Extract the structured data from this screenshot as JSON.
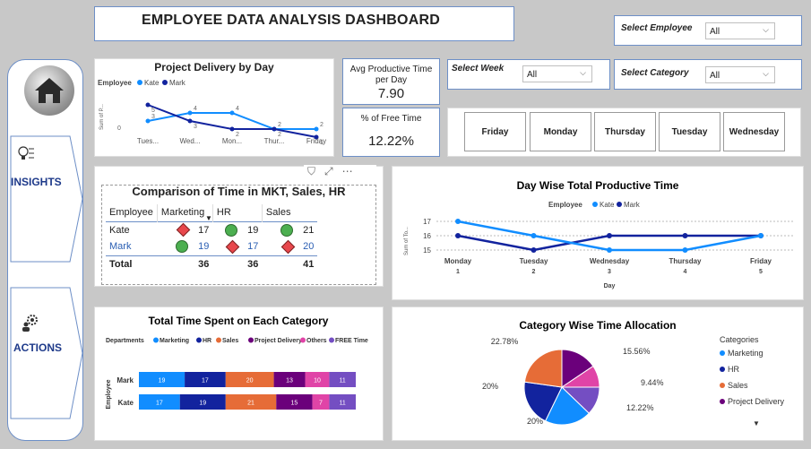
{
  "page_title": "EMPLOYEE DATA ANALYSIS DASHBOARD",
  "slicers": {
    "employee": {
      "label": "Select Employee",
      "value": "All"
    },
    "week": {
      "label": "Select Week",
      "value": "All"
    },
    "category": {
      "label": "Select Category",
      "value": "All"
    }
  },
  "nav": {
    "insights": "INSIGHTS",
    "actions": "ACTIONS"
  },
  "kpis": {
    "avg_prod_label": "Avg Productive Time per Day",
    "avg_prod_value": "7.90",
    "free_label": "% of Free Time",
    "free_value": "12.22%"
  },
  "day_buttons": [
    "Friday",
    "Monday",
    "Thursday",
    "Tuesday",
    "Wednesday"
  ],
  "colors": {
    "kate": "#118dff",
    "mark": "#12239e",
    "marketing": "#118dff",
    "hr": "#12239e",
    "sales": "#e66c37",
    "project_delivery": "#6b007b",
    "others": "#e044a7",
    "free_time": "#744ec2"
  },
  "chart_data": [
    {
      "type": "line",
      "title": "Project Delivery by Day",
      "legend_title": "Employee",
      "legend_position": "top-left",
      "ylabel": "Sum of P...",
      "categories": [
        "Tues...",
        "Wed...",
        "Mon...",
        "Thur...",
        "Friday"
      ],
      "series": [
        {
          "name": "Kate",
          "values": [
            3,
            4,
            4,
            2,
            2
          ]
        },
        {
          "name": "Mark",
          "values": [
            5,
            3,
            2,
            2,
            1
          ]
        }
      ],
      "data_labels": [
        "3",
        "4",
        "4",
        "2",
        "2",
        "5",
        "3",
        "2",
        "2",
        "1"
      ]
    },
    {
      "type": "table",
      "title": "Comparison of Time in MKT, Sales, HR",
      "columns": [
        "Employee",
        "Marketing",
        "HR",
        "Sales"
      ],
      "rows": [
        {
          "employee": "Kate",
          "marketing": "17",
          "hr": "19",
          "sales": "21",
          "icons": [
            "diamond",
            "circle",
            "circle"
          ]
        },
        {
          "employee": "Mark",
          "marketing": "19",
          "hr": "17",
          "sales": "20",
          "icons": [
            "circle",
            "diamond",
            "diamond"
          ]
        }
      ],
      "total": {
        "label": "Total",
        "marketing": "36",
        "hr": "36",
        "sales": "41"
      }
    },
    {
      "type": "line",
      "title": "Day Wise Total Productive Time",
      "legend_title": "Employee",
      "legend_position": "top-center",
      "xlabel": "Day",
      "ylabel": "Sum of To...",
      "categories": [
        "Monday",
        "Tuesday",
        "Wednesday",
        "Thursday",
        "Friday"
      ],
      "category_numbers": [
        "1",
        "2",
        "3",
        "4",
        "5"
      ],
      "y_ticks": [
        "15",
        "16",
        "17"
      ],
      "ylim": [
        14.5,
        17.3
      ],
      "series": [
        {
          "name": "Kate",
          "values": [
            17,
            16,
            15,
            15,
            16
          ]
        },
        {
          "name": "Mark",
          "values": [
            16,
            15,
            16,
            16,
            16
          ]
        }
      ]
    },
    {
      "type": "bar",
      "title": "Total Time Spent on Each Category",
      "legend_title": "Departments",
      "legend": [
        "Marketing",
        "HR",
        "Sales",
        "Project Delivery",
        "Others",
        "FREE Time"
      ],
      "ylabel": "Employee",
      "categories": [
        "Mark",
        "Kate"
      ],
      "series": [
        {
          "name": "Marketing",
          "values": [
            19,
            17
          ]
        },
        {
          "name": "HR",
          "values": [
            17,
            19
          ]
        },
        {
          "name": "Sales",
          "values": [
            20,
            21
          ]
        },
        {
          "name": "Project Delivery",
          "values": [
            13,
            15
          ]
        },
        {
          "name": "Others",
          "values": [
            10,
            7
          ]
        },
        {
          "name": "FREE Time",
          "values": [
            11,
            11
          ]
        }
      ]
    },
    {
      "type": "pie",
      "title": "Category Wise Time Allocation",
      "legend_title": "Categories",
      "legend": [
        "Marketing",
        "HR",
        "Sales",
        "Project Delivery"
      ],
      "slices": [
        {
          "label": "Project Delivery",
          "value": 15.56,
          "text": "15.56%"
        },
        {
          "label": "Others",
          "value": 9.44,
          "text": "9.44%"
        },
        {
          "label": "FREE Time",
          "value": 12.22,
          "text": "12.22%"
        },
        {
          "label": "Marketing",
          "value": 20,
          "text": "20%"
        },
        {
          "label": "HR",
          "value": 20,
          "text": "20%"
        },
        {
          "label": "Sales",
          "value": 22.78,
          "text": "22.78%"
        }
      ]
    }
  ]
}
